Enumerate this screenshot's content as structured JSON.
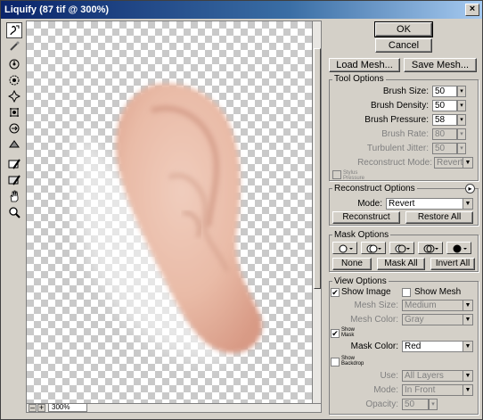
{
  "window": {
    "title": "Liquify (87 tif @ 300%)",
    "close": "×"
  },
  "canvas": {
    "zoom": "300%"
  },
  "tools": [
    "warp-tool",
    "reconstruct-tool",
    "twirl-clockwise-tool",
    "pucker-tool",
    "bloat-tool",
    "push-left-tool",
    "mirror-tool",
    "turbulence-tool",
    "freeze-mask-tool",
    "thaw-mask-tool",
    "hand-tool",
    "zoom-tool"
  ],
  "buttons": {
    "ok": "OK",
    "cancel": "Cancel",
    "load_mesh": "Load Mesh...",
    "save_mesh": "Save Mesh..."
  },
  "tool_options": {
    "title": "Tool Options",
    "brush_size_label": "Brush Size:",
    "brush_size": "50",
    "brush_density_label": "Brush Density:",
    "brush_density": "50",
    "brush_pressure_label": "Brush Pressure:",
    "brush_pressure": "58",
    "brush_rate_label": "Brush Rate:",
    "brush_rate": "80",
    "turbulent_jitter_label": "Turbulent Jitter:",
    "turbulent_jitter": "50",
    "reconstruct_mode_label": "Reconstruct Mode:",
    "reconstruct_mode": "Revert",
    "stylus_pressure_label": "Stylus Pressure"
  },
  "reconstruct_options": {
    "title": "Reconstruct Options",
    "mode_label": "Mode:",
    "mode": "Revert",
    "reconstruct_button": "Reconstruct",
    "restore_all_button": "Restore All"
  },
  "mask_options": {
    "title": "Mask Options",
    "none_button": "None",
    "mask_all_button": "Mask All",
    "invert_all_button": "Invert All"
  },
  "view_options": {
    "title": "View Options",
    "show_image_label": "Show Image",
    "show_image": true,
    "show_mesh_label": "Show Mesh",
    "show_mesh": false,
    "mesh_size_label": "Mesh Size:",
    "mesh_size": "Medium",
    "mesh_color_label": "Mesh Color:",
    "mesh_color": "Gray",
    "show_mask_label": "Show Mask",
    "show_mask": true,
    "mask_color_label": "Mask Color:",
    "mask_color": "Red",
    "show_backdrop_label": "Show Backdrop",
    "show_backdrop": false,
    "use_label": "Use:",
    "use": "All Layers",
    "mode_label": "Mode:",
    "mode": "In Front",
    "opacity_label": "Opacity:",
    "opacity": "50"
  },
  "colors": {
    "title_start": "#0a246a",
    "title_end": "#a6caf0",
    "face": "#d4d0c8",
    "skin": "#e6b9a4"
  }
}
